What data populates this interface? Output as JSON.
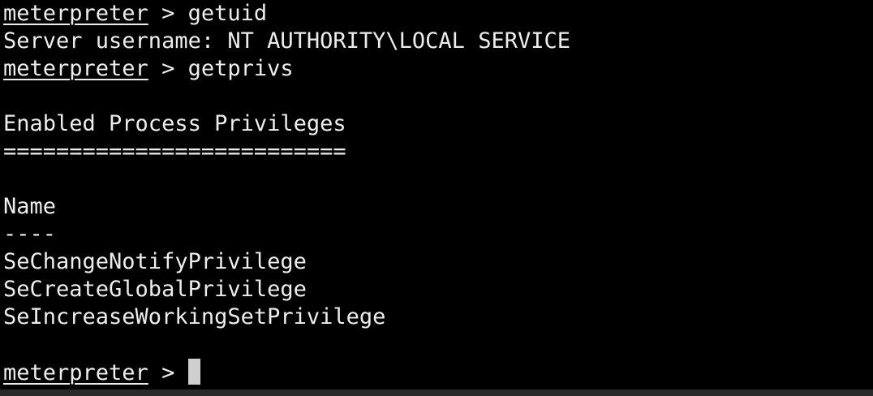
{
  "terminal": {
    "prompt": "meterpreter",
    "separator": " > ",
    "commands": {
      "getuid": "getuid",
      "getprivs": "getprivs"
    },
    "getuid_output": "Server username: NT AUTHORITY\\LOCAL SERVICE",
    "section_title": "Enabled Process Privileges",
    "section_rule": "==========================",
    "column_header": "Name",
    "column_rule": "----",
    "privileges": [
      "SeChangeNotifyPrivilege",
      "SeCreateGlobalPrivilege",
      "SeIncreaseWorkingSetPrivilege"
    ]
  },
  "colors": {
    "background": "#000000",
    "foreground": "#ededed",
    "cursor": "#cfcfcf"
  }
}
